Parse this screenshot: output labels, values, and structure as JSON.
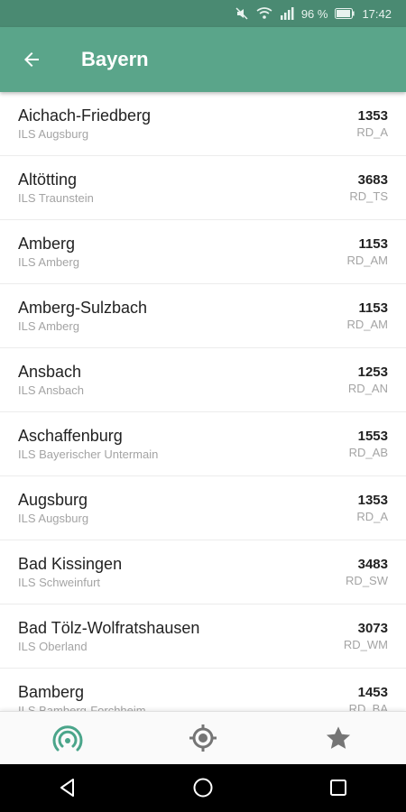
{
  "status": {
    "battery": "96 %",
    "time": "17:42",
    "icons": [
      "mute-icon",
      "wifi-icon",
      "signal-icon",
      "battery-icon"
    ]
  },
  "header": {
    "title": "Bayern",
    "back_icon": "arrow-left-icon"
  },
  "colors": {
    "status_bar": "#4a8a72",
    "app_bar": "#5aa58a",
    "accent": "#4aa58a"
  },
  "list": [
    {
      "name": "Aichach-Friedberg",
      "sub": "ILS Augsburg",
      "code": "1353",
      "code_sub": "RD_A"
    },
    {
      "name": "Altötting",
      "sub": "ILS Traunstein",
      "code": "3683",
      "code_sub": "RD_TS"
    },
    {
      "name": "Amberg",
      "sub": "ILS Amberg",
      "code": "1153",
      "code_sub": "RD_AM"
    },
    {
      "name": "Amberg-Sulzbach",
      "sub": "ILS Amberg",
      "code": "1153",
      "code_sub": "RD_AM"
    },
    {
      "name": "Ansbach",
      "sub": "ILS Ansbach",
      "code": "1253",
      "code_sub": "RD_AN"
    },
    {
      "name": "Aschaffenburg",
      "sub": "ILS Bayerischer Untermain",
      "code": "1553",
      "code_sub": "RD_AB"
    },
    {
      "name": "Augsburg",
      "sub": "ILS Augsburg",
      "code": "1353",
      "code_sub": "RD_A"
    },
    {
      "name": "Bad Kissingen",
      "sub": "ILS Schweinfurt",
      "code": "3483",
      "code_sub": "RD_SW"
    },
    {
      "name": "Bad Tölz-Wolfratshausen",
      "sub": "ILS Oberland",
      "code": "3073",
      "code_sub": "RD_WM"
    },
    {
      "name": "Bamberg",
      "sub": "ILS Bamberg-Forchheim",
      "code": "1453",
      "code_sub": "RD_BA"
    }
  ],
  "bottom_nav": [
    {
      "icon": "radio-signal-icon",
      "active": true
    },
    {
      "icon": "location-target-icon",
      "active": false
    },
    {
      "icon": "star-icon",
      "active": false
    }
  ],
  "system_nav": [
    "back-triangle-icon",
    "home-circle-icon",
    "recents-square-icon"
  ]
}
